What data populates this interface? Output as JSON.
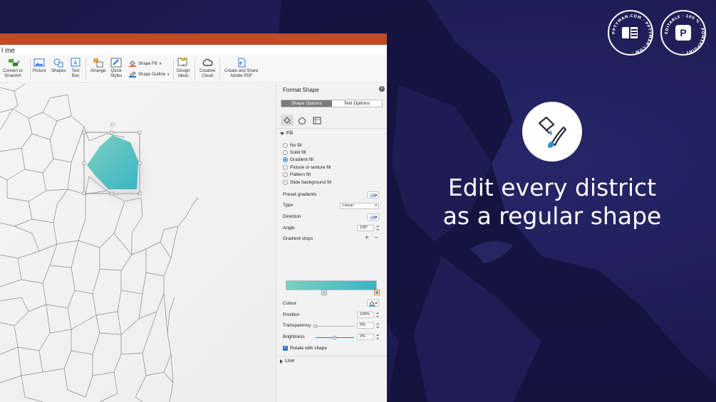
{
  "app": {
    "menu_fragment": "l me",
    "accent_color": "#c24a24"
  },
  "ribbon": {
    "convert_label_1": "Convert to",
    "convert_label_2": "SmartArt",
    "picture": "Picture",
    "shapes": "Shapes",
    "textbox_1": "Text",
    "textbox_2": "Box",
    "arrange": "Arrange",
    "quick_1": "Quick",
    "quick_2": "Styles",
    "shape_fill": "Shape Fill",
    "shape_outline": "Shape Outline",
    "design_1": "Design",
    "design_2": "Ideas",
    "cc_1": "Creative",
    "cc_2": "Cloud",
    "pdf_1": "Create and Share",
    "pdf_2": "Adobe PDF"
  },
  "panel": {
    "title": "Format Shape",
    "tabs": [
      "Shape Options",
      "Text Options"
    ],
    "fill_section": "Fill",
    "fill_options": [
      {
        "label": "No fill",
        "selected": false
      },
      {
        "label": "Solid fill",
        "selected": false
      },
      {
        "label": "Gradient fill",
        "selected": true
      },
      {
        "label": "Picture or texture fill",
        "selected": false
      },
      {
        "label": "Pattern fill",
        "selected": false
      },
      {
        "label": "Slide background fill",
        "selected": false
      }
    ],
    "preset_gradients": "Preset gradients",
    "type_label": "Type",
    "type_value": "Linear",
    "direction_label": "Direction",
    "angle_label": "Angle",
    "angle_value": "135°",
    "gradient_stops": "Gradient stops",
    "plus": "+",
    "minus": "−",
    "gradient_colors": [
      "#7fd0c0",
      "#38b4c4"
    ],
    "colour_label": "Colour",
    "position_label": "Position",
    "position_value": "100%",
    "transparency_label": "Transparency",
    "transparency_value": "0%",
    "transparency_level": 0,
    "brightness_label": "Brightness",
    "brightness_value": "0%",
    "brightness_level": 0.5,
    "rotate_label": "Rotate with shape",
    "rotate_checked": true,
    "line_section": "Line"
  },
  "promo": {
    "headline_1": "Edit every district",
    "headline_2": "as a regular shape",
    "icon": "paint-bucket-brush-icon",
    "badge_1_text": "PPTYMAN.COM · PPTYMAN.COM ·",
    "badge_2_text": "EDITABLE · 100 % · POWERPOINT ·",
    "badge_2_letter": "P",
    "background_color": "#1b1a4c"
  }
}
